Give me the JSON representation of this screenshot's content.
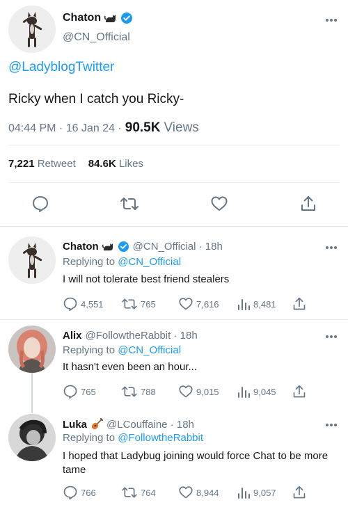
{
  "main": {
    "name": "Chaton",
    "handle": "@CN_Official",
    "mention": "@LadyblogTwitter",
    "text": "Ricky when I catch you Ricky-",
    "time": "04:44 PM · 16 Jan 24 ·",
    "views_count": "90.5K",
    "views_label": "Views",
    "retweets_count": "7,221",
    "retweets_label": "Retweet",
    "likes_count": "84.6K",
    "likes_label": "Likes"
  },
  "replies": [
    {
      "name": "Chaton",
      "handle_time": "@CN_Official · 18h",
      "replying_label": "Replying to",
      "replying_to": "@CN_Official",
      "text": "I will not tolerate best friend stealers",
      "comments": "4,551",
      "retweets": "765",
      "likes": "7,616",
      "views": "8,481"
    },
    {
      "name": "Alix",
      "handle_time": "@FollowtheRabbit · 18h",
      "replying_label": "Replying to",
      "replying_to": "@CN_Official",
      "text": "It hasn't even been an hour...",
      "comments": "765",
      "retweets": "788",
      "likes": "9,015",
      "views": "9,045"
    },
    {
      "name": "Luka",
      "handle_time": "@LCouffaine · 18h",
      "replying_label": "Replying to",
      "replying_to": "@FollowtheRabbit",
      "text": "I hoped that Ladybug joining would force Chat to be more tame",
      "comments": "766",
      "retweets": "764",
      "likes": "8,944",
      "views": "9,057"
    }
  ],
  "icons": {
    "verified": "verified-badge-icon",
    "cat": "cat-emoji-icon",
    "guitar": "guitar-emoji-icon",
    "comment": "comment-icon",
    "retweet": "retweet-icon",
    "like": "heart-icon",
    "views": "views-bar-chart-icon",
    "share": "share-icon",
    "more": "more-dots-icon"
  },
  "colors": {
    "accent": "#1d9bf0",
    "text": "#14171a",
    "secondary": "#657786",
    "divider": "#e6ecf0"
  }
}
